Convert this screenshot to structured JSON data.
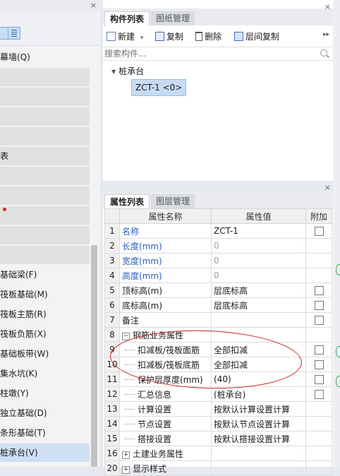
{
  "left_panel": {
    "close_label": "×",
    "items": [
      {
        "label": "幕墙(Q)",
        "style": "plain"
      },
      {
        "label": "",
        "style": "gray"
      },
      {
        "label": "",
        "style": "gray"
      },
      {
        "label": "",
        "style": "gray"
      },
      {
        "label": "",
        "style": "gray"
      },
      {
        "label": "表",
        "style": "gray"
      },
      {
        "label": "",
        "style": "gray"
      },
      {
        "label": "",
        "style": "gray"
      },
      {
        "label": "",
        "style": "gray"
      },
      {
        "label": "",
        "style": "gray"
      },
      {
        "label": "",
        "style": "gray"
      },
      {
        "label": "基础梁(F)",
        "style": "plain"
      },
      {
        "label": "筏板基础(M)",
        "style": "plain"
      },
      {
        "label": "筏板主筋(R)",
        "style": "plain"
      },
      {
        "label": "筏板负筋(X)",
        "style": "plain"
      },
      {
        "label": "基础板带(W)",
        "style": "plain"
      },
      {
        "label": "集水坑(K)",
        "style": "plain"
      },
      {
        "label": "柱墩(Y)",
        "style": "plain"
      },
      {
        "label": "独立基础(D)",
        "style": "plain"
      },
      {
        "label": "条形基础(T)",
        "style": "plain"
      },
      {
        "label": "桩承台(V)",
        "style": "selected"
      }
    ]
  },
  "component_panel": {
    "tabs": [
      "构件列表",
      "图纸管理"
    ],
    "close_label": "×",
    "toolbar": {
      "new_label": "新建",
      "new_dropdown": "▾",
      "copy_label": "复制",
      "delete_label": "删除",
      "floor_copy_label": "层间复制",
      "more_label": "▸▸"
    },
    "search": {
      "placeholder": "搜索构件..."
    },
    "tree": {
      "root_label": "桩承台",
      "node_label": "ZCT-1 <0>"
    }
  },
  "property_panel": {
    "tabs": [
      "属性列表",
      "图层管理"
    ],
    "close_label": "×",
    "columns": [
      "",
      "属性名称",
      "属性值",
      "附加"
    ],
    "rows": [
      {
        "num": "1",
        "name": "名称",
        "value": "ZCT-1",
        "name_style": "blue",
        "value_style": "",
        "check": true,
        "indent": 0,
        "sign": ""
      },
      {
        "num": "2",
        "name": "长度(mm)",
        "value": "0",
        "name_style": "blue",
        "value_style": "muted",
        "check": false,
        "indent": 0,
        "sign": ""
      },
      {
        "num": "3",
        "name": "宽度(mm)",
        "value": "0",
        "name_style": "blue",
        "value_style": "muted",
        "check": false,
        "indent": 0,
        "sign": ""
      },
      {
        "num": "4",
        "name": "高度(mm)",
        "value": "0",
        "name_style": "blue",
        "value_style": "muted",
        "check": false,
        "indent": 0,
        "sign": ""
      },
      {
        "num": "5",
        "name": "顶标高(m)",
        "value": "层底标高",
        "name_style": "",
        "value_style": "",
        "check": true,
        "indent": 0,
        "sign": ""
      },
      {
        "num": "6",
        "name": "底标高(m)",
        "value": "层底标高",
        "name_style": "",
        "value_style": "",
        "check": true,
        "indent": 0,
        "sign": ""
      },
      {
        "num": "7",
        "name": "备注",
        "value": "",
        "name_style": "",
        "value_style": "",
        "check": true,
        "indent": 0,
        "sign": ""
      },
      {
        "num": "8",
        "name": "钢筋业务属性",
        "value": "",
        "name_style": "",
        "value_style": "",
        "check": false,
        "indent": 0,
        "sign": "−"
      },
      {
        "num": "9",
        "name": "扣减板/筏板面筋",
        "value": "全部扣减",
        "name_style": "",
        "value_style": "",
        "check": true,
        "indent": 1,
        "sign": ""
      },
      {
        "num": "10",
        "name": "扣减板/筏板底筋",
        "value": "全部扣减",
        "name_style": "",
        "value_style": "",
        "check": true,
        "indent": 1,
        "sign": ""
      },
      {
        "num": "11",
        "name": "保护层厚度(mm)",
        "value": "(40)",
        "name_style": "",
        "value_style": "",
        "check": true,
        "indent": 1,
        "sign": ""
      },
      {
        "num": "12",
        "name": "汇总信息",
        "value": "(桩承台)",
        "name_style": "",
        "value_style": "",
        "check": true,
        "indent": 1,
        "sign": ""
      },
      {
        "num": "13",
        "name": "计算设置",
        "value": "按默认计算设置计算",
        "name_style": "",
        "value_style": "",
        "check": false,
        "indent": 1,
        "sign": ""
      },
      {
        "num": "14",
        "name": "节点设置",
        "value": "按默认节点设置计算",
        "name_style": "",
        "value_style": "",
        "check": false,
        "indent": 1,
        "sign": ""
      },
      {
        "num": "15",
        "name": "搭接设置",
        "value": "按默认搭接设置计算",
        "name_style": "",
        "value_style": "",
        "check": false,
        "indent": 1,
        "sign": ""
      },
      {
        "num": "16",
        "name": "土建业务属性",
        "value": "",
        "name_style": "",
        "value_style": "",
        "check": false,
        "indent": 0,
        "sign": "+"
      },
      {
        "num": "20",
        "name": "显示样式",
        "value": "",
        "name_style": "",
        "value_style": "",
        "check": false,
        "indent": 0,
        "sign": "+"
      }
    ]
  },
  "colors": {
    "accent_blue": "#2a5cc4",
    "selection": "#cfe0f5",
    "annotation_red": "#d02020"
  }
}
